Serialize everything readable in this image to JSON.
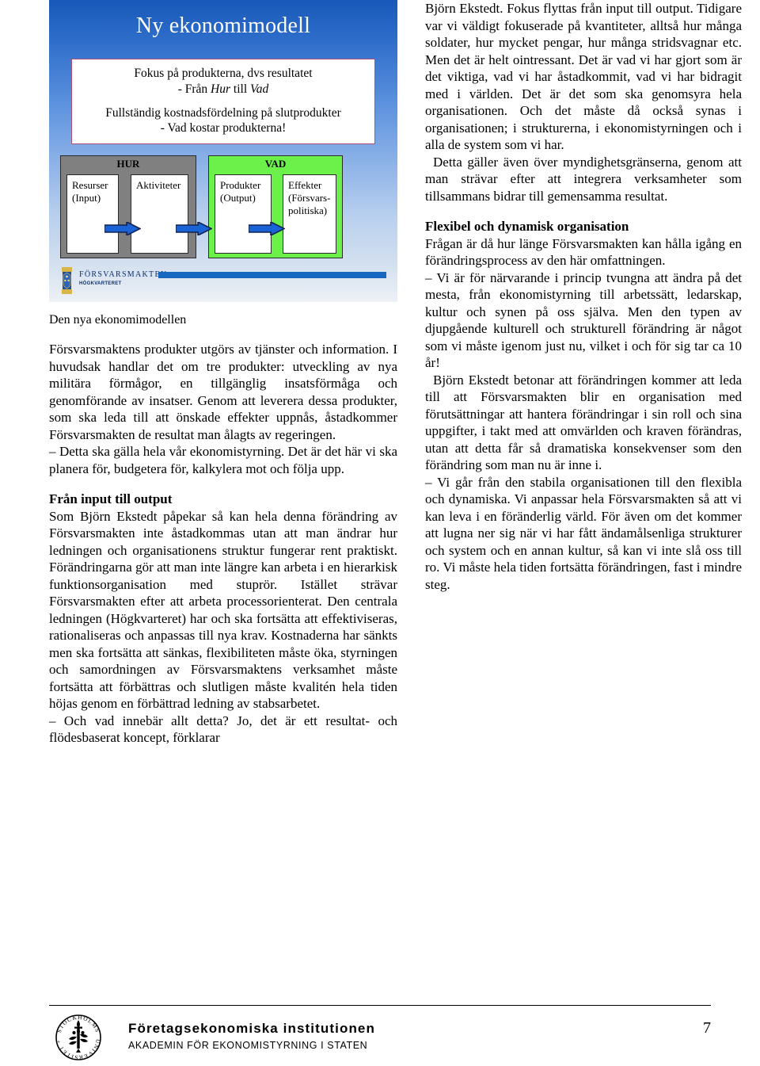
{
  "slide": {
    "title": "Ny ekonomimodell",
    "callout": {
      "line1": "Fokus på produkterna, dvs resultatet",
      "line2_pre": "- Från ",
      "line2_it1": "Hur",
      "line2_mid": " till ",
      "line2_it2": "Vad",
      "line3": "Fullständig kostnadsfördelning på slutprodukter",
      "line4": "- Vad kostar produkterna!"
    },
    "diagram": {
      "group_hur": "HUR",
      "group_vad": "VAD",
      "cells": [
        {
          "line1": "Resurser",
          "line2": "(Input)"
        },
        {
          "line1": "Aktiviteter",
          "line2": ""
        },
        {
          "line1": "Produkter",
          "line2": "(Output)"
        },
        {
          "line1": "Effekter",
          "line2": "(Försvars-",
          "line3": "politiska)"
        }
      ],
      "arrow_color": "#1a63d6",
      "arrow_outline": "#10224f",
      "hur_fill": "#808080",
      "vad_fill": "#6cf04a"
    },
    "logo": {
      "name": "FÖRSVARSMAKTEN",
      "sub": "HÖGKVARTERET",
      "bar_color": "#1667c0"
    }
  },
  "left_column": {
    "caption": "Den nya ekonomimodellen",
    "para1": "Försvarsmaktens produkter utgörs av tjänster och information. I huvudsak handlar det om tre produkter: utveckling av nya militära förmågor, en tillgänglig insatsförmåga och genomförande av insatser. Genom att leverera dessa produkter, som ska leda till att önskade effekter uppnås, åstadkommer Försvarsmakten de resultat man ålagts av regeringen.",
    "para2": "– Detta ska gälla hela vår ekonomistyrning. Det är det här vi ska planera för, budgetera för, kalkylera mot och följa upp.",
    "heading": "Från input till output",
    "para3": "Som Björn Ekstedt påpekar så kan hela denna förändring av Försvarsmakten inte åstadkommas utan att man ändrar hur ledningen och organisationens struktur fungerar rent praktiskt. Förändringarna gör att man inte längre kan arbeta i en hierarkisk funktionsorganisation med stuprör. Istället strävar Försvarsmakten efter att arbeta processorienterat. Den centrala ledningen (Högkvarteret) har och ska fortsätta att effektiviseras, rationaliseras och anpassas till nya krav. Kostnaderna har sänkts men ska fortsätta att sänkas, flexibiliteten måste öka, styrningen och samordningen av Försvarsmaktens verksamhet måste fortsätta att förbättras och slutligen måste kvalitén hela tiden höjas genom en förbättrad ledning av stabsarbetet.",
    "para4": "– Och vad innebär allt detta? Jo, det är ett resultat- och flödesbaserat koncept, förklarar"
  },
  "right_column": {
    "para1": "Björn Ekstedt. Fokus flyttas från input till output. Tidigare var vi väldigt fokuserade på kvantiteter, alltså hur många soldater, hur mycket pengar, hur många stridsvagnar etc. Men det är helt ointressant. Det är vad vi har gjort som är det viktiga, vad vi har åstadkommit, vad vi har bidragit med i världen. Det är det som ska genomsyra hela organisationen. Och det måste då också synas i organisationen; i strukturerna, i ekonomistyrningen och i alla de system som vi har.",
    "para2": "Detta gäller även över myndighetsgränserna, genom att man strävar efter att integrera verksamheter som tillsammans bidrar till gemensamma resultat.",
    "heading": "Flexibel och dynamisk organisation",
    "para3": "Frågan är då hur länge Försvarsmakten kan hålla igång en förändringsprocess av den här omfattningen.",
    "para4": "– Vi är för närvarande i princip tvungna att ändra på det mesta, från ekonomistyrning till arbetssätt, ledarskap, kultur och synen på oss själva. Men den typen av djupgående kulturell och strukturell förändring är något som vi måste igenom just nu, vilket i och för sig tar ca 10 år!",
    "para5": "Björn Ekstedt betonar att förändringen kommer att leda till att Försvarsmakten blir en organisation med förutsättningar att hantera förändringar i sin roll och sina uppgifter, i takt med att omvärlden och kraven förändras, utan att detta får så dramatiska konsekvenser som den förändring som man nu är inne i.",
    "para6": "– Vi går från den stabila organisationen till den flexibla och dynamiska. Vi anpassar hela Försvarsmakten så att vi kan leva i en föränderlig värld. För även om det kommer att lugna ner sig när vi har fått ändamålsenliga strukturer och system och en annan kultur, så kan vi inte slå oss till ro. Vi måste hela tiden fortsätta förändringen, fast i mindre steg."
  },
  "footer": {
    "institution": "Företagsekonomiska institutionen",
    "academy": "AKADEMIN FÖR EKONOMISTYRNING I STATEN",
    "page_number": "7",
    "logo_alt": "STOCKHOLMS UNIVERSITET"
  }
}
